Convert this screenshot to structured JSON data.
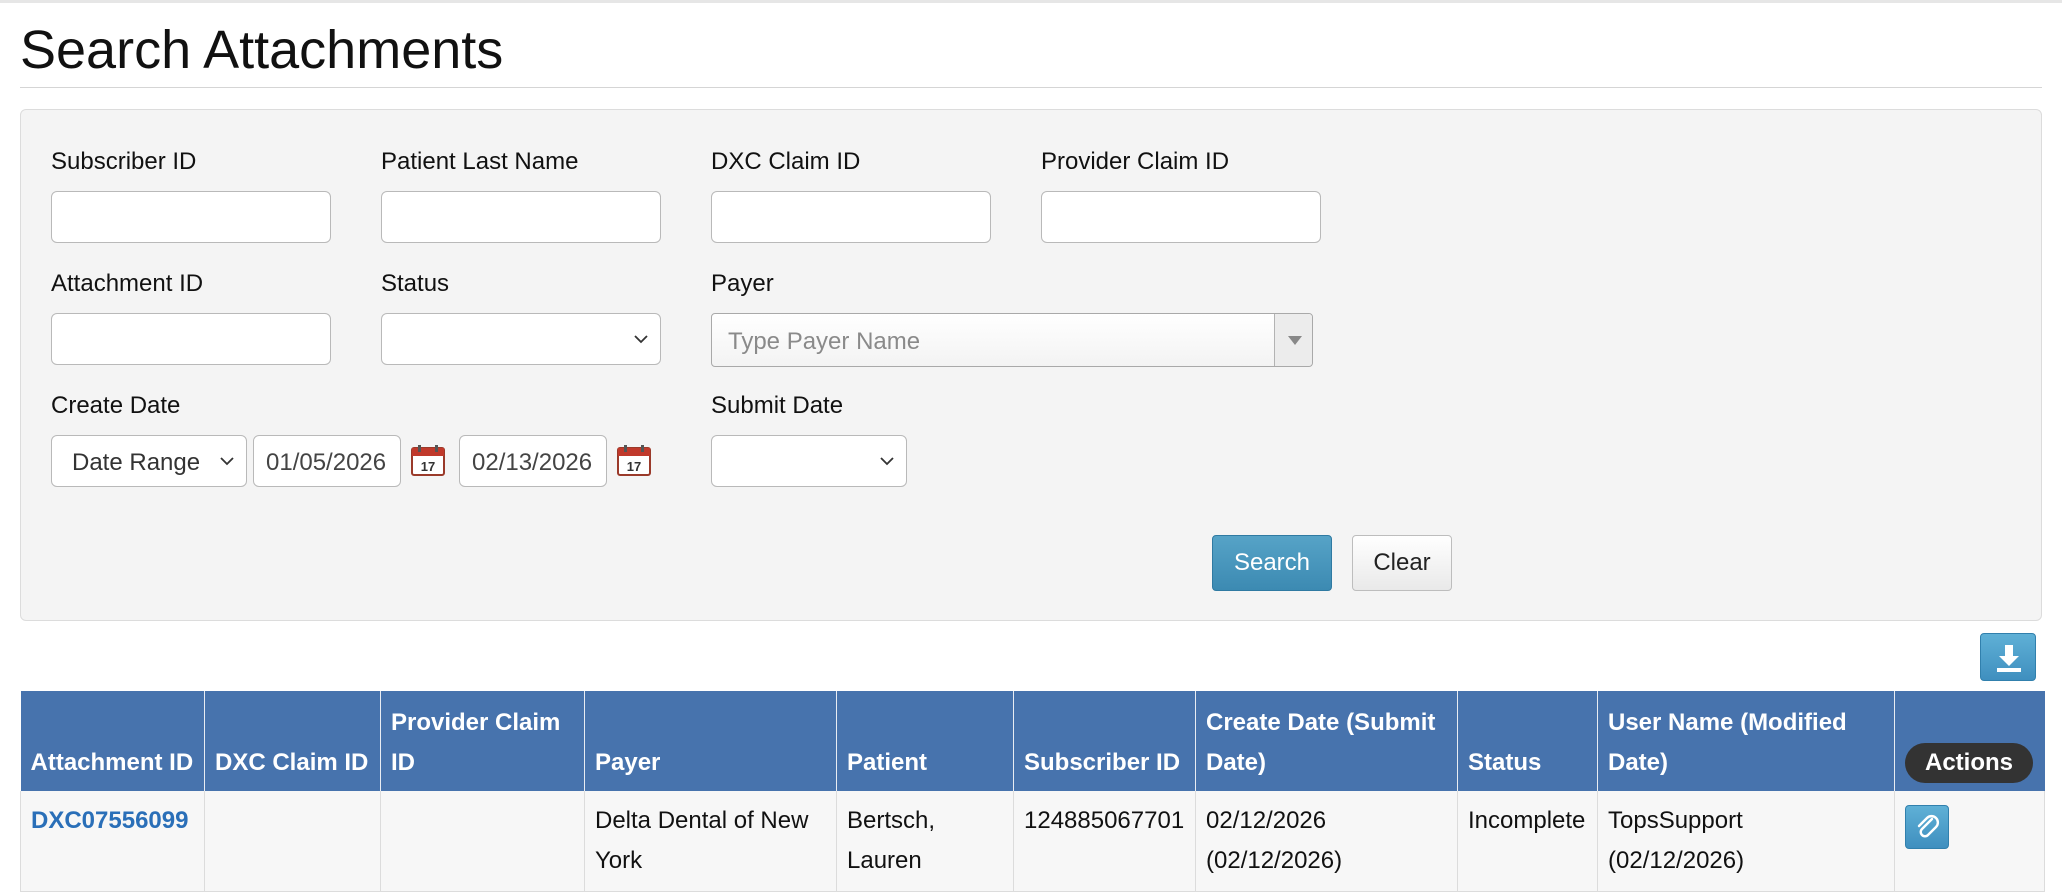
{
  "page": {
    "title": "Search Attachments"
  },
  "filters": {
    "subscriber_id": {
      "label": "Subscriber ID",
      "value": ""
    },
    "patient_last_name": {
      "label": "Patient Last Name",
      "value": ""
    },
    "dxc_claim_id": {
      "label": "DXC Claim ID",
      "value": ""
    },
    "provider_claim_id": {
      "label": "Provider Claim ID",
      "value": ""
    },
    "attachment_id": {
      "label": "Attachment ID",
      "value": ""
    },
    "status": {
      "label": "Status",
      "selected": ""
    },
    "payer": {
      "label": "Payer",
      "placeholder": "Type Payer Name"
    },
    "create_date": {
      "label": "Create Date",
      "mode": "Date Range",
      "from": "01/05/2026",
      "to": "02/13/2026"
    },
    "submit_date": {
      "label": "Submit Date",
      "selected": ""
    }
  },
  "buttons": {
    "search": "Search",
    "clear": "Clear"
  },
  "calendar_day": "17",
  "table": {
    "headers": [
      "Attachment ID",
      "DXC Claim ID",
      "Provider Claim ID",
      "Payer",
      "Patient",
      "Subscriber ID",
      "Create Date (Submit Date)",
      "Status",
      "User Name (Modified Date)",
      "Actions"
    ],
    "rows": [
      {
        "attachment_id": "DXC07556099",
        "dxc_claim_id": "",
        "provider_claim_id": "",
        "payer": "Delta Dental of New York",
        "patient": "Bertsch, Lauren",
        "subscriber_id": "124885067701",
        "create_date": "02/12/2026 (02/12/2026)",
        "status": "Incomplete",
        "user_name": "TopsSupport (02/12/2026)"
      }
    ]
  },
  "colors": {
    "header_blue": "#4773ad",
    "button_blue": "#4a98c0",
    "link_blue": "#2a6fb8",
    "panel_bg": "#f4f4f4"
  }
}
